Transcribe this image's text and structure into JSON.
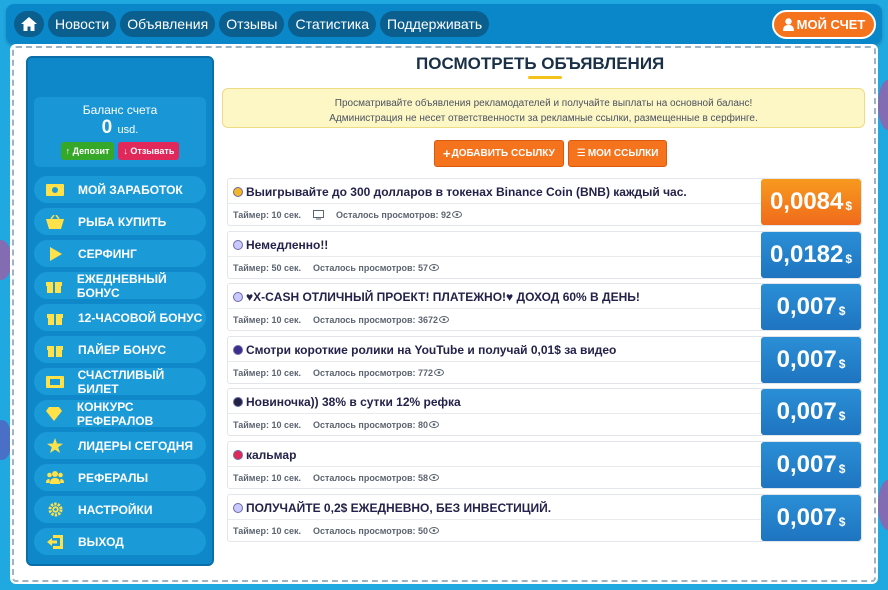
{
  "nav": {
    "items": [
      "Новости",
      "Объявления",
      "Отзывы",
      "Статистика",
      "Поддерживать"
    ],
    "account": "МОЙ СЧЕТ"
  },
  "balance": {
    "label": "Баланс счета",
    "value": "0",
    "unit": "usd.",
    "deposit": "Депозит",
    "withdraw": "Отзывать"
  },
  "menu": [
    {
      "label": "МОЙ ЗАРАБОТОК",
      "icon": "money-icon"
    },
    {
      "label": "РЫБА КУПИТЬ",
      "icon": "basket-icon"
    },
    {
      "label": "СЕРФИНГ",
      "icon": "play-icon"
    },
    {
      "label": "ЕЖЕДНЕВНЫЙ БОНУС",
      "icon": "gift-icon"
    },
    {
      "label": "12-ЧАСОВОЙ БОНУС",
      "icon": "gift-icon"
    },
    {
      "label": "ПАЙЕР БОНУС",
      "icon": "gift-icon"
    },
    {
      "label": "СЧАСТЛИВЫЙ БИЛЕТ",
      "icon": "ticket-icon"
    },
    {
      "label": "КОНКУРС РЕФЕРАЛОВ",
      "icon": "diamond-icon"
    },
    {
      "label": "ЛИДЕРЫ СЕГОДНЯ",
      "icon": "star-icon"
    },
    {
      "label": "РЕФЕРАЛЫ",
      "icon": "users-icon"
    },
    {
      "label": "НАСТРОЙКИ",
      "icon": "gear-icon"
    },
    {
      "label": "ВЫХОД",
      "icon": "exit-icon"
    }
  ],
  "page": {
    "title": "ПОСМОТРЕТЬ ОБЪЯВЛЕНИЯ",
    "notice_line1": "Просматривайте объявления рекламодателей и получайте выплаты на основной баланс!",
    "notice_line2": "Администрация не несет ответственности за рекламные ссылки, размещенные в серфинге.",
    "add_link": "ДОБАВИТЬ ССЫЛКУ",
    "my_links": "МОИ ССЫЛКИ"
  },
  "ads": [
    {
      "title": "Выигрывайте до 300 долларов в токенах Binance Coin (BNB) каждый час.",
      "timer": "Таймер: 10 сек.",
      "views": "Осталось просмотров: 92",
      "price": "0,0084",
      "currency": "$",
      "hot": true,
      "icon_color": "#f2b62b"
    },
    {
      "title": "Немедленно!!",
      "timer": "Таймер: 50 сек.",
      "views": "Осталось просмотров: 57",
      "price": "0,0182",
      "currency": "$",
      "hot": false,
      "icon_color": "#c9c8ff"
    },
    {
      "title": "♥X-CASH ОТЛИЧНЫЙ ПРОЕКТ! ПЛАТЕЖНО!♥ ДОХОД 60% В ДЕНЬ!",
      "timer": "Таймер: 10 сек.",
      "views": "Осталось просмотров: 3672",
      "price": "0,007",
      "currency": "$",
      "hot": false,
      "icon_color": "#c9c8ff"
    },
    {
      "title": "Смотри короткие ролики на YouTube и получай 0,01$ за видео",
      "timer": "Таймер: 10 сек.",
      "views": "Осталось просмотров: 772",
      "price": "0,007",
      "currency": "$",
      "hot": false,
      "icon_color": "#3b2f8c"
    },
    {
      "title": "Новиночка)) 38% в сутки 12% рефка",
      "timer": "Таймер: 10 сек.",
      "views": "Осталось просмотров: 80",
      "price": "0,007",
      "currency": "$",
      "hot": false,
      "icon_color": "#222244"
    },
    {
      "title": "кальмар",
      "timer": "Таймер: 10 сек.",
      "views": "Осталось просмотров: 58",
      "price": "0,007",
      "currency": "$",
      "hot": false,
      "icon_color": "#e0285a"
    },
    {
      "title": "ПОЛУЧАЙТЕ 0,2$ ЕЖЕДНЕВНО, БЕЗ ИНВЕСТИЦИЙ.",
      "timer": "Таймер: 10 сек.",
      "views": "Осталось просмотров: 50",
      "price": "0,007",
      "currency": "$",
      "hot": false,
      "icon_color": "#c9c8ff"
    }
  ]
}
